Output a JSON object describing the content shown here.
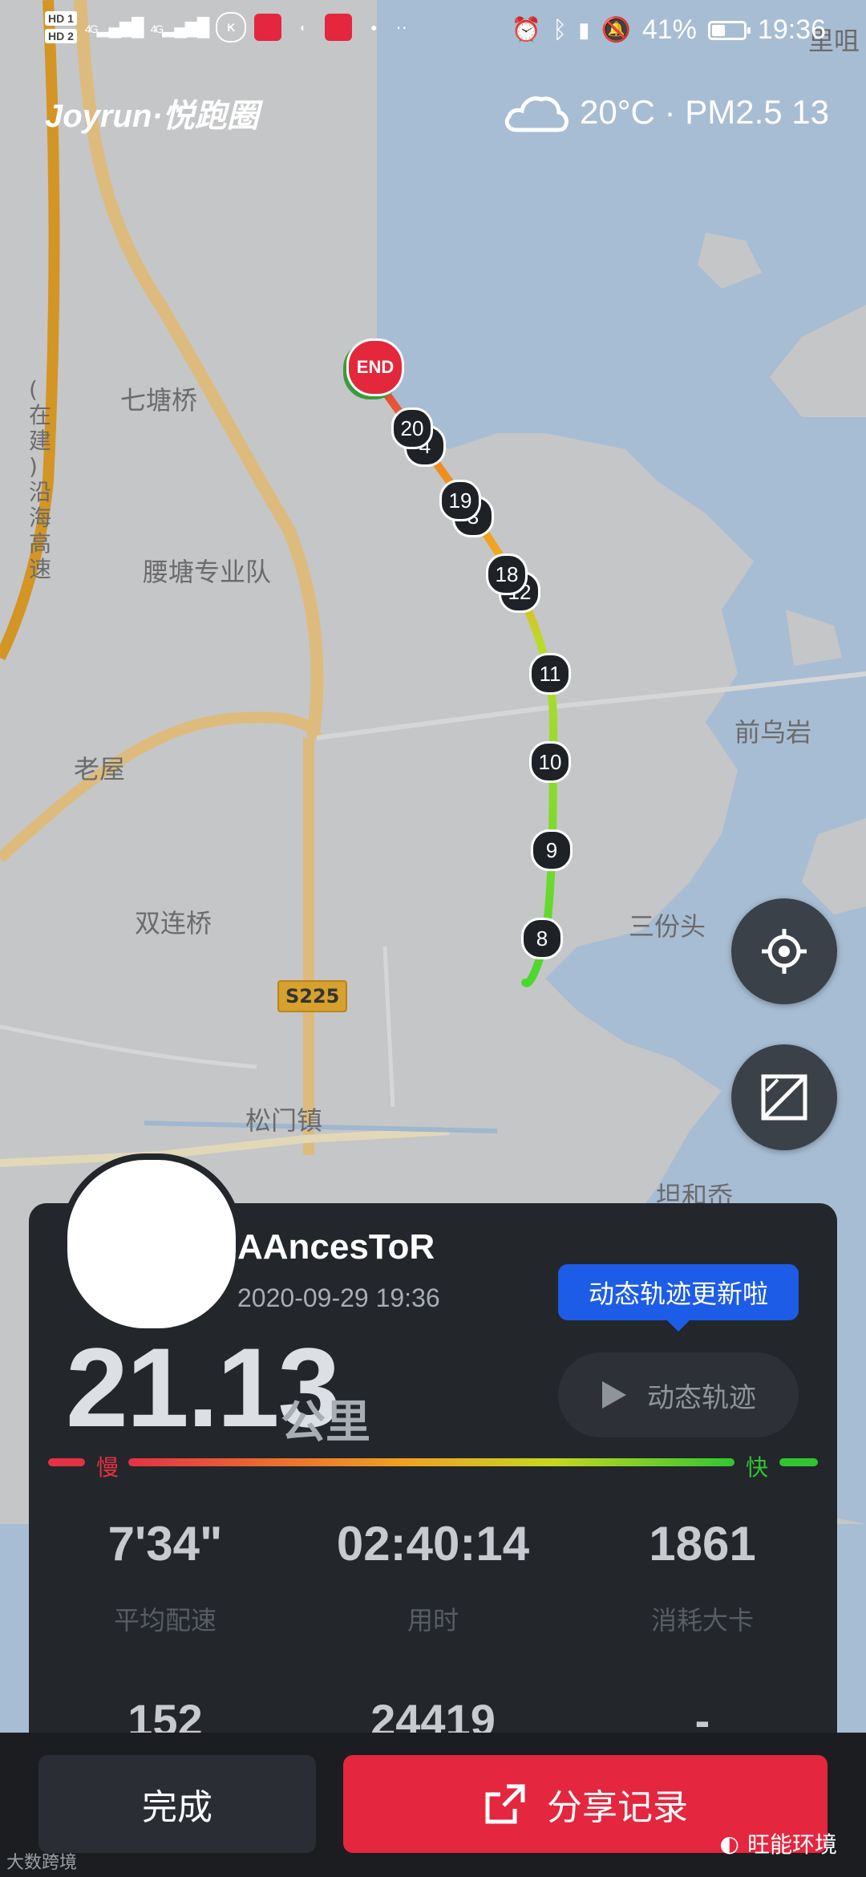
{
  "status_bar": {
    "sim1": "HD 1",
    "sim2": "HD 2",
    "net": "4G",
    "battery": "41%",
    "battery_level": 0.41,
    "time": "19:36"
  },
  "brand": {
    "logo_text": "Joyrun·悦跑圈"
  },
  "weather": {
    "text": "20°C · PM2.5 13",
    "icon": "cloud-icon"
  },
  "map": {
    "place_labels": [
      "七塘桥",
      "腰塘专业队",
      "老屋",
      "双连桥",
      "松门镇",
      "前乌岩",
      "三份头",
      "坦和岙",
      "(在建)沿海高速",
      "里咀"
    ],
    "road_shield": "S225",
    "end_label": "END",
    "km_markers": [
      "20",
      "4",
      "19",
      "3",
      "18",
      "12",
      "11",
      "10",
      "9",
      "8"
    ]
  },
  "controls": {
    "locate_icon": "locate-target-icon",
    "expand_icon": "expand-map-icon"
  },
  "panel": {
    "username": "AAncesToR",
    "datetime": "2020-09-29 19:36",
    "tooltip": "动态轨迹更新啦",
    "dynamic_button": "动态轨迹",
    "distance": "21.13",
    "distance_unit": "公里",
    "pace_slow": "慢",
    "pace_fast": "快",
    "stats": [
      {
        "value": "7'34\"",
        "label": "平均配速"
      },
      {
        "value": "02:40:14",
        "label": "用时"
      },
      {
        "value": "1861",
        "label": "消耗大卡"
      }
    ],
    "stats_row2": [
      "152",
      "24419",
      "-"
    ]
  },
  "actions": {
    "done": "完成",
    "share": "分享记录"
  },
  "watermarks": {
    "left": "大数跨境",
    "right": "旺能环境"
  },
  "colors": {
    "route_slow": "#e53243",
    "route_mid": "#f0a020",
    "route_fast": "#31c531",
    "share": "#e4263f",
    "tooltip": "#1d5ce6"
  }
}
